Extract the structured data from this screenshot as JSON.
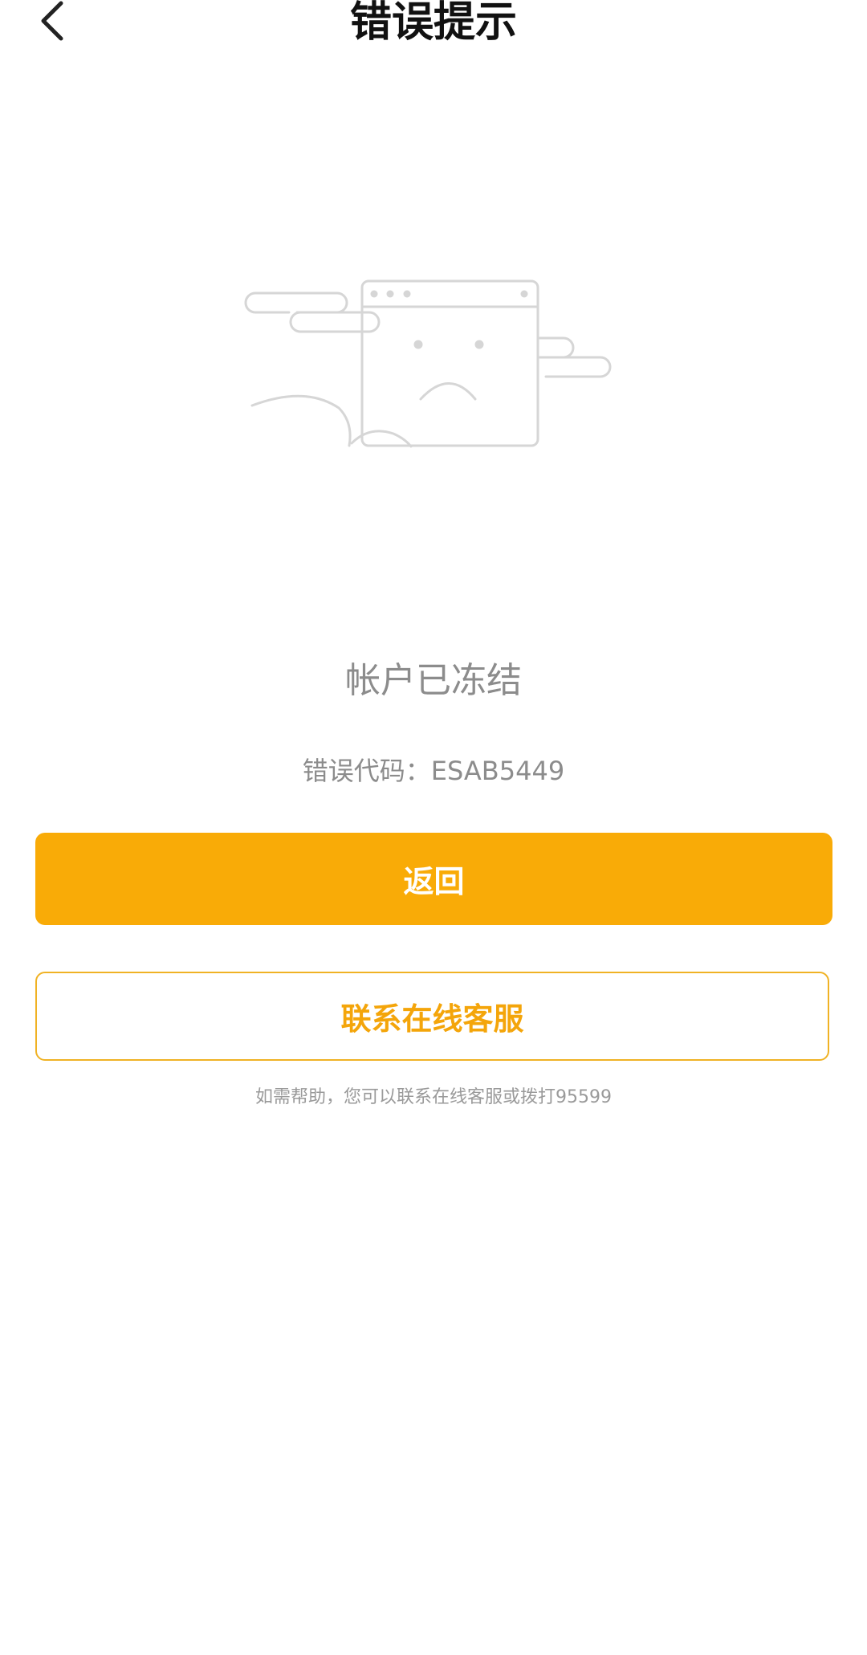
{
  "header": {
    "back_icon": "chevron-left-icon",
    "title": "错误提示"
  },
  "illustration": {
    "icon": "sad-browser-window-illustration",
    "stroke_color": "#d6d6d6"
  },
  "status": {
    "title": "帐户已冻结",
    "error_code": "错误代码：ESAB5449"
  },
  "actions": {
    "back_label": "返回",
    "contact_label": "联系在线客服"
  },
  "help": {
    "text": "如需帮助，您可以联系在线客服或拨打95599"
  },
  "colors": {
    "accent": "#f9ab07",
    "text_muted": "#8c8c8c"
  }
}
